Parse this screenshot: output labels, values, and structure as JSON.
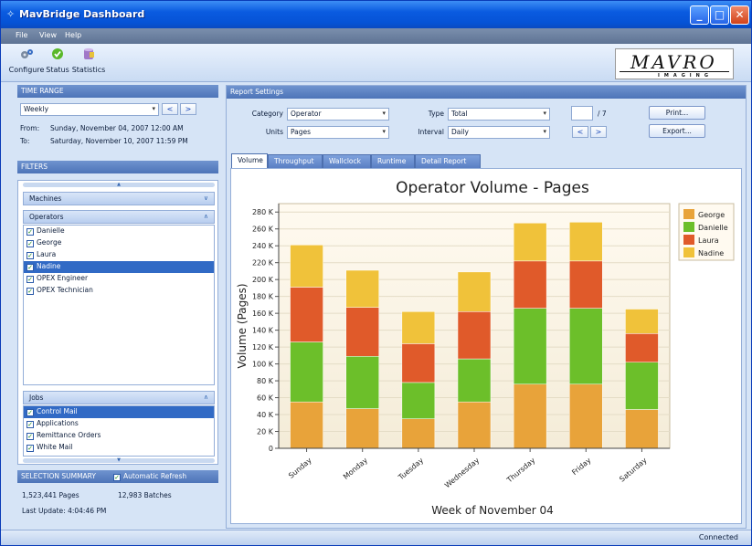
{
  "window": {
    "title": "MavBridge Dashboard"
  },
  "menu": [
    "File",
    "View",
    "Help"
  ],
  "toolbar": {
    "configure": "Configure",
    "status": "Status",
    "statistics": "Statistics"
  },
  "logo": {
    "main": "MAVRO",
    "sub": "IMAGING"
  },
  "time_range": {
    "header": "TIME RANGE",
    "period": "Weekly",
    "prev": "<",
    "next": ">",
    "from_label": "From:",
    "from_value": "Sunday, November 04, 2007 12:00 AM",
    "to_label": "To:",
    "to_value": "Saturday, November 10, 2007 11:59 PM"
  },
  "filters": {
    "header": "FILTERS",
    "machines": "Machines",
    "operators": "Operators",
    "operator_items": [
      {
        "label": "Danielle",
        "checked": true,
        "selected": false
      },
      {
        "label": "George",
        "checked": true,
        "selected": false
      },
      {
        "label": "Laura",
        "checked": true,
        "selected": false
      },
      {
        "label": "Nadine",
        "checked": true,
        "selected": true
      },
      {
        "label": "OPEX Engineer",
        "checked": true,
        "selected": false
      },
      {
        "label": "OPEX Technician",
        "checked": true,
        "selected": false
      }
    ],
    "jobs": "Jobs",
    "job_items": [
      {
        "label": "Control Mail",
        "checked": true,
        "selected": true
      },
      {
        "label": "Applications",
        "checked": true,
        "selected": false
      },
      {
        "label": "Remittance Orders",
        "checked": true,
        "selected": false
      },
      {
        "label": "White Mail",
        "checked": true,
        "selected": false
      }
    ]
  },
  "summary": {
    "header": "SELECTION SUMMARY",
    "auto_refresh": "Automatic Refresh",
    "pages": "1,523,441 Pages",
    "batches": "12,983 Batches",
    "last_update": "Last Update: 4:04:46 PM"
  },
  "report_settings": {
    "header": "Report Settings",
    "category_label": "Category",
    "category_value": "Operator",
    "units_label": "Units",
    "units_value": "Pages",
    "type_label": "Type",
    "type_value": "Total",
    "interval_label": "Interval",
    "interval_value": "Daily",
    "page_value": "",
    "page_total": "/ 7",
    "prev": "<",
    "next": ">",
    "print": "Print...",
    "export": "Export..."
  },
  "tabs": [
    "Volume",
    "Throughput",
    "Wallclock",
    "Runtime",
    "Detail Report"
  ],
  "status": {
    "text": "Connected"
  },
  "chart_data": {
    "type": "bar",
    "stacked": true,
    "title": "Operator Volume - Pages",
    "xlabel": "Week of November 04",
    "ylabel": "Volume (Pages)",
    "ylim": [
      0,
      290000
    ],
    "yticks": [
      "0",
      "20 K",
      "40 K",
      "60 K",
      "80 K",
      "100 K",
      "120 K",
      "140 K",
      "160 K",
      "180 K",
      "200 K",
      "220 K",
      "240 K",
      "260 K",
      "280 K"
    ],
    "categories": [
      "Sunday",
      "Monday",
      "Tuesday",
      "Wednesday",
      "Thursday",
      "Friday",
      "Saturday"
    ],
    "series": [
      {
        "name": "George",
        "color": "#e8a33a",
        "values": [
          55000,
          47000,
          35000,
          55000,
          76000,
          76000,
          46000
        ]
      },
      {
        "name": "Danielle",
        "color": "#6cbf2a",
        "values": [
          71000,
          62000,
          43000,
          51000,
          90000,
          90000,
          56000
        ]
      },
      {
        "name": "Laura",
        "color": "#e05a2a",
        "values": [
          65000,
          58000,
          46000,
          56000,
          56000,
          56000,
          34000
        ]
      },
      {
        "name": "Nadine",
        "color": "#f0c23a",
        "values": [
          50000,
          44000,
          38000,
          47000,
          45000,
          46000,
          29000
        ]
      }
    ],
    "legend": "top-right",
    "grid": true
  }
}
